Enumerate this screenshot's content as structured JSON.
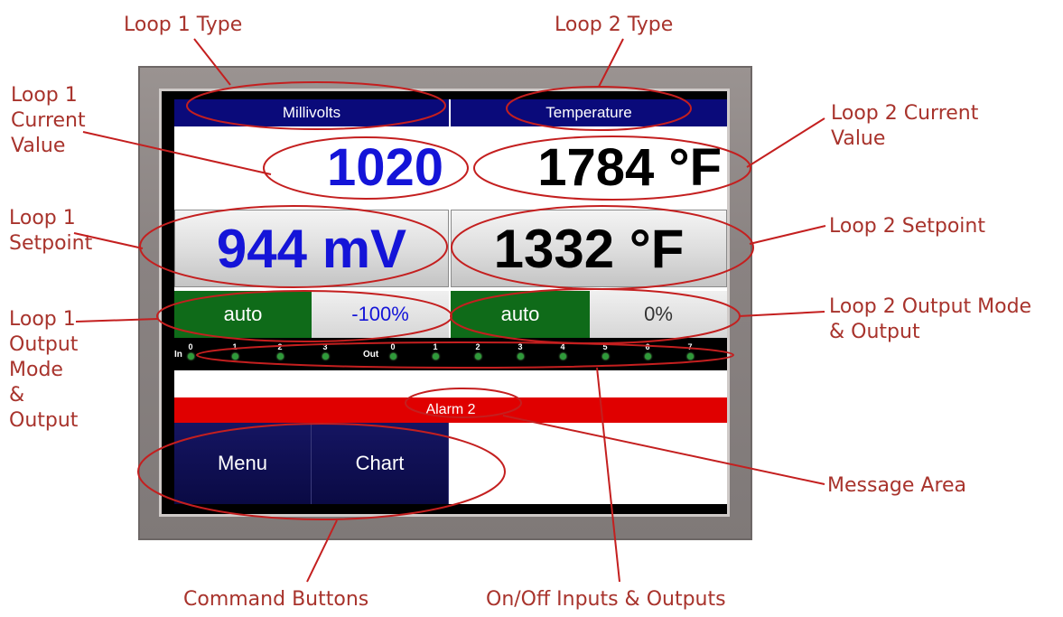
{
  "callouts": {
    "loop1_type": "Loop 1 Type",
    "loop2_type": "Loop 2 Type",
    "loop1_current_value": "Loop 1\nCurrent\nValue",
    "loop2_current_value": "Loop 2 Current\nValue",
    "loop1_setpoint": "Loop 1\nSetpoint",
    "loop2_setpoint": "Loop 2 Setpoint",
    "loop1_output": "Loop 1\nOutput\nMode\n&\nOutput",
    "loop2_output": "Loop 2 Output Mode\n& Output",
    "message_area": "Message Area",
    "command_buttons": "Command Buttons",
    "io": "On/Off Inputs & Outputs"
  },
  "display": {
    "loop1": {
      "type": "Millivolts",
      "current": "1020",
      "setpoint": "944 mV",
      "mode": "auto",
      "output": "-100%"
    },
    "loop2": {
      "type": "Temperature",
      "current": "1784 °F",
      "setpoint": "1332 °F",
      "mode": "auto",
      "output": "0%"
    },
    "io": {
      "in_label": "In",
      "out_label": "Out",
      "inputs": [
        "0",
        "1",
        "2",
        "3"
      ],
      "outputs": [
        "0",
        "1",
        "2",
        "3",
        "4",
        "5",
        "6",
        "7"
      ]
    },
    "alarm": "Alarm 2",
    "buttons": {
      "menu": "Menu",
      "chart": "Chart"
    }
  },
  "colors": {
    "callout": "#a8332c",
    "header": "#0a0a7a",
    "loop1_text": "#1414d8",
    "loop2_text": "#000000",
    "mode_bg": "#0f6b19",
    "alarm_bg": "#e00000",
    "led_on": "#2f9a3a"
  }
}
